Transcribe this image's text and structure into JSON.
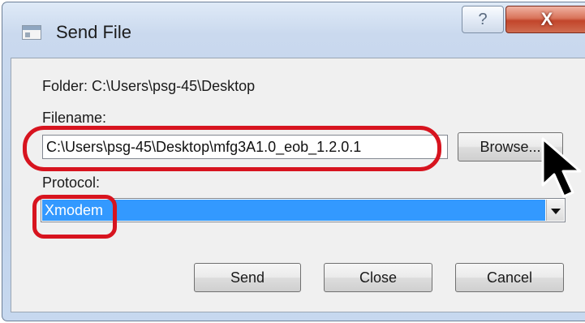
{
  "window": {
    "title": "Send File",
    "help_glyph": "?",
    "close_glyph": "X",
    "icon": "window-app-icon"
  },
  "folder": {
    "label": "Folder:",
    "value": "C:\\Users\\psg-45\\Desktop"
  },
  "filename": {
    "label": "Filename:",
    "value": "C:\\Users\\psg-45\\Desktop\\mfg3A1.0_eob_1.2.0.1"
  },
  "browse": {
    "label": "Browse..."
  },
  "protocol": {
    "label": "Protocol:",
    "selected": "Xmodem"
  },
  "buttons": {
    "send": "Send",
    "close": "Close",
    "cancel": "Cancel"
  },
  "colors": {
    "highlight": "#d7141f",
    "selection": "#3399ff",
    "close_button": "#c2452b"
  }
}
